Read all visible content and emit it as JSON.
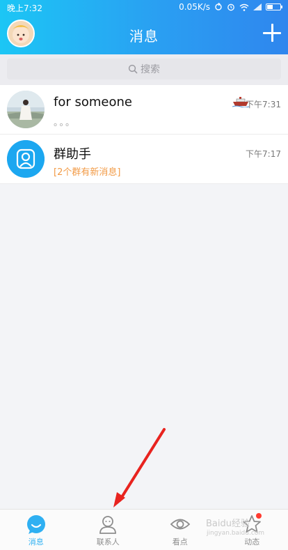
{
  "status_bar": {
    "time": "晚上7:32",
    "network_speed": "0.05K/s"
  },
  "header": {
    "title": "消息"
  },
  "search": {
    "placeholder": "搜索"
  },
  "chats": [
    {
      "name": "for  someone",
      "preview": "。。。",
      "time": "下午7:31"
    },
    {
      "name": "群助手",
      "preview": "[2个群有新消息]",
      "time": "下午7:17"
    }
  ],
  "bottom_nav": [
    {
      "label": "消息",
      "icon": "message-icon",
      "active": true
    },
    {
      "label": "联系人",
      "icon": "contacts-icon",
      "active": false
    },
    {
      "label": "看点",
      "icon": "eye-icon",
      "active": false
    },
    {
      "label": "动态",
      "icon": "star-icon",
      "active": false
    }
  ],
  "watermark": {
    "text": "Baidu经验",
    "sub": "jingyan.baidu.com"
  },
  "colors": {
    "header_gradient_start": "#1cc6f5",
    "header_gradient_end": "#2f86ee",
    "active_tab": "#2fb0f2",
    "highlight_text": "#f29a45",
    "annotation_arrow": "#e8231f",
    "badge": "#ff3b30"
  }
}
